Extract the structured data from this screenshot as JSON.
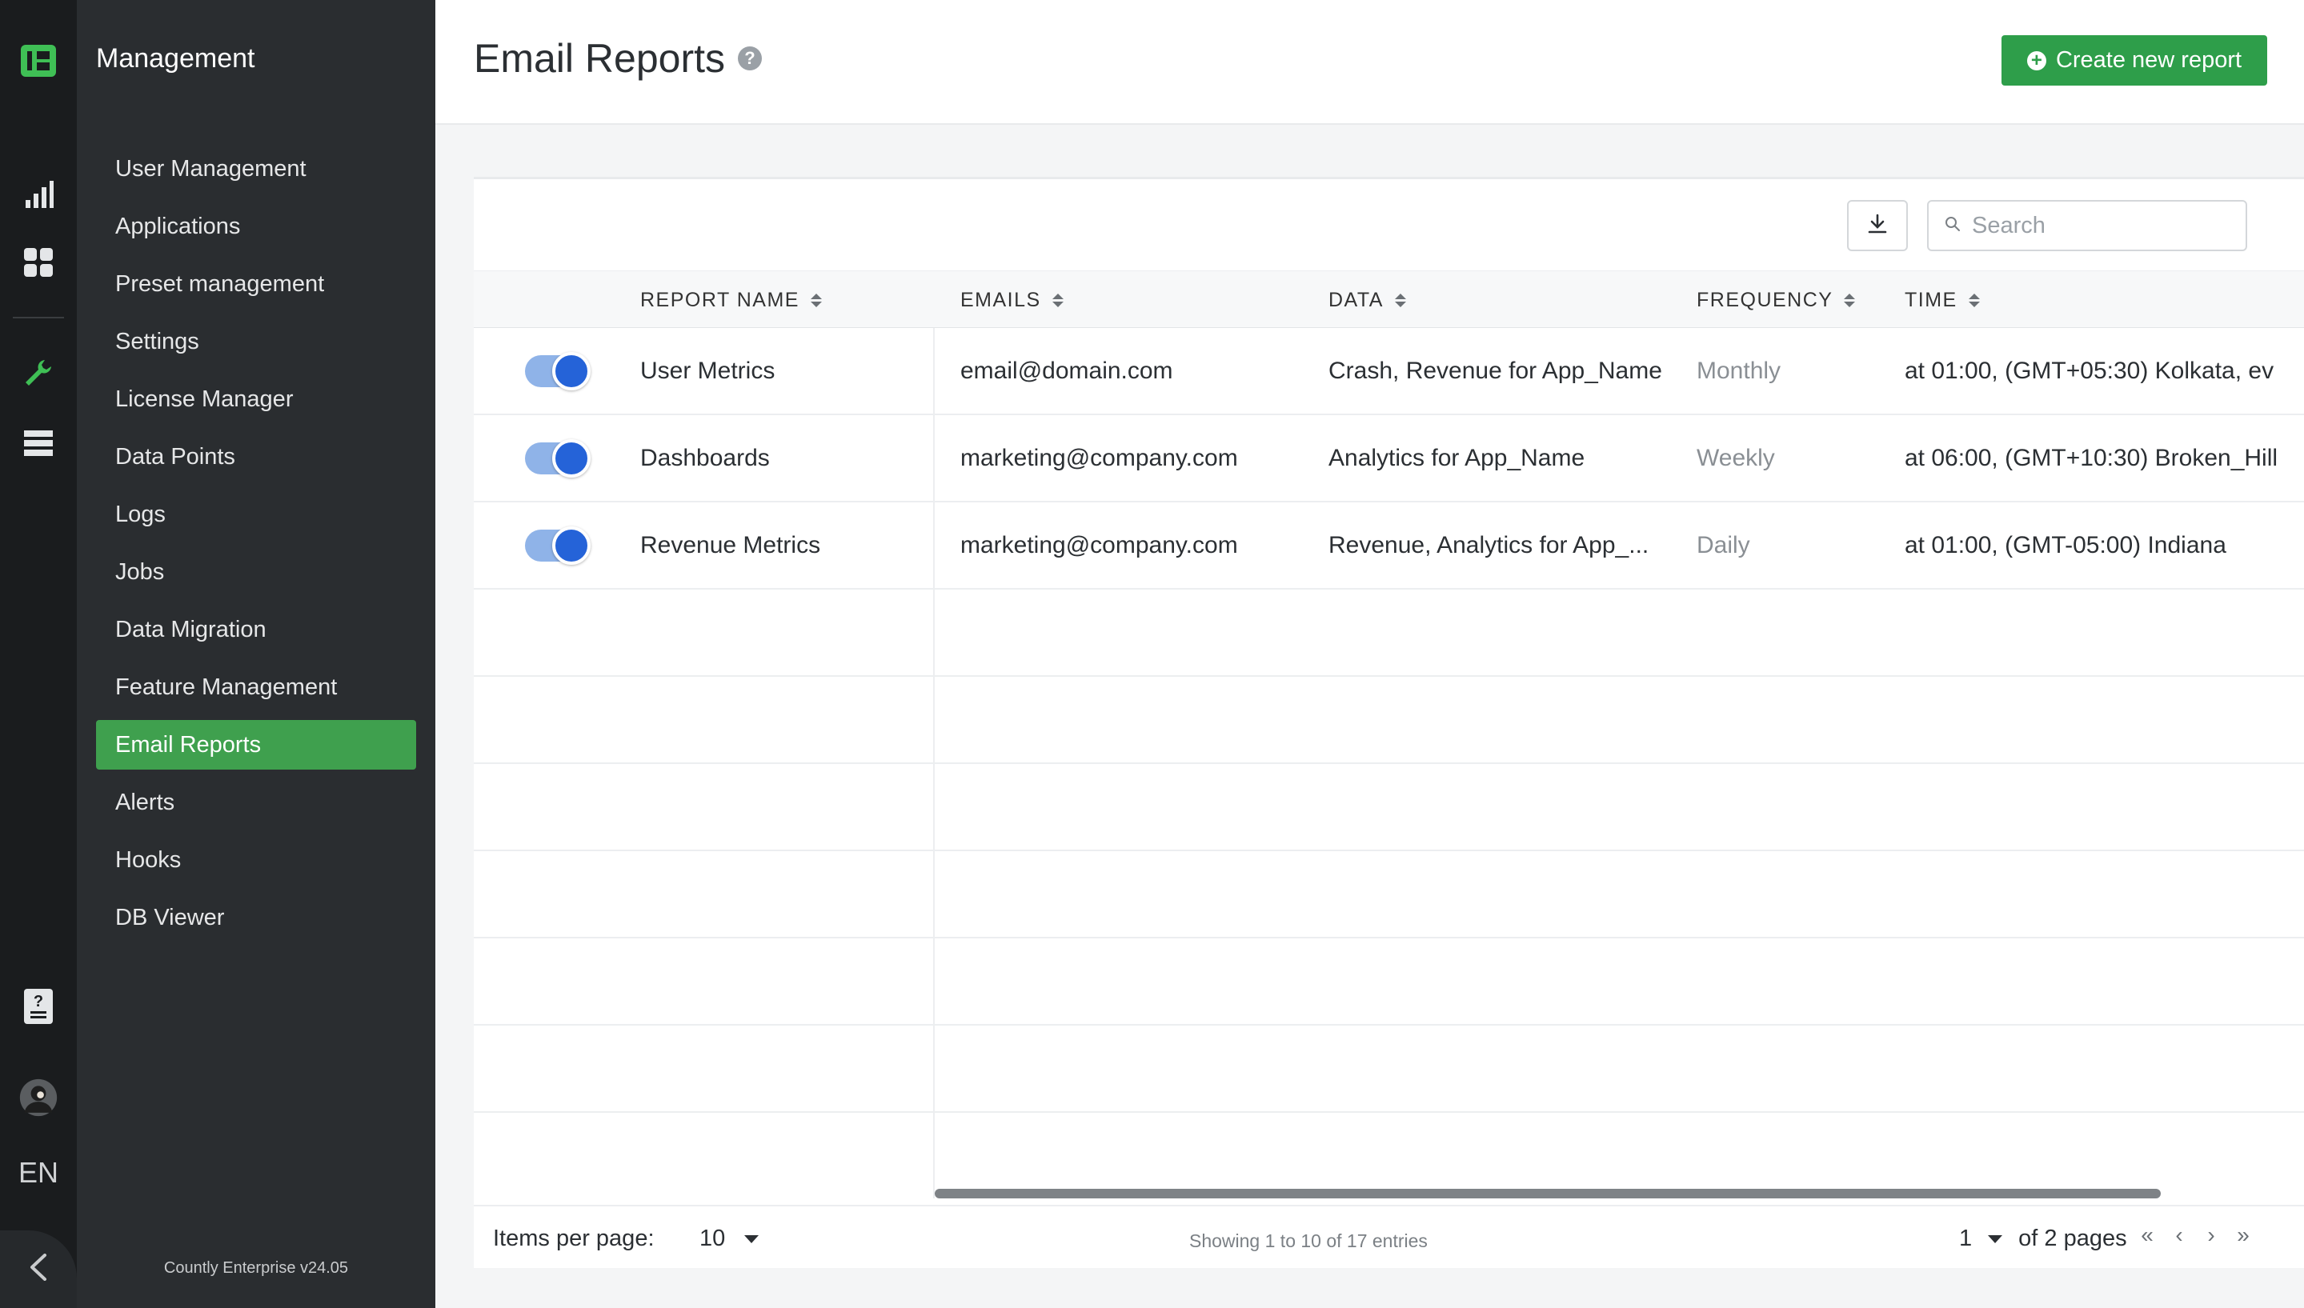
{
  "sidebar": {
    "title": "Management",
    "items": [
      {
        "label": "User Management",
        "active": false
      },
      {
        "label": "Applications",
        "active": false
      },
      {
        "label": "Preset management",
        "active": false
      },
      {
        "label": "Settings",
        "active": false
      },
      {
        "label": "License Manager",
        "active": false
      },
      {
        "label": "Data Points",
        "active": false
      },
      {
        "label": "Logs",
        "active": false
      },
      {
        "label": "Jobs",
        "active": false
      },
      {
        "label": "Data Migration",
        "active": false
      },
      {
        "label": "Feature Management",
        "active": false
      },
      {
        "label": "Email Reports",
        "active": true
      },
      {
        "label": "Alerts",
        "active": false
      },
      {
        "label": "Hooks",
        "active": false
      },
      {
        "label": "DB Viewer",
        "active": false
      }
    ],
    "version": "Countly Enterprise v24.05"
  },
  "rail": {
    "icons": [
      "countly-logo-icon",
      "analytics-bar-chart-icon",
      "dashboard-grid-icon",
      "management-wrench-icon",
      "database-table-icon",
      "help-book-icon",
      "user-avatar-icon",
      "collapse-chevron-icon"
    ],
    "language": "EN"
  },
  "header": {
    "title": "Email Reports",
    "help_glyph": "?",
    "create_label": "Create new report"
  },
  "toolbar": {
    "search_placeholder": "Search"
  },
  "table": {
    "columns": [
      "REPORT NAME",
      "EMAILS",
      "DATA",
      "FREQUENCY",
      "TIME"
    ],
    "rows": [
      {
        "enabled": true,
        "name": "User Metrics",
        "emails": "email@domain.com",
        "data": "Crash, Revenue for App_Name",
        "frequency": "Monthly",
        "time": "at 01:00, (GMT+05:30) Kolkata, ev"
      },
      {
        "enabled": true,
        "name": "Dashboards",
        "emails": "marketing@company.com",
        "data": "Analytics for App_Name",
        "frequency": "Weekly",
        "time": "at 06:00, (GMT+10:30) Broken_Hill"
      },
      {
        "enabled": true,
        "name": "Revenue Metrics",
        "emails": "marketing@company.com",
        "data": "Revenue, Analytics for App_...",
        "frequency": "Daily",
        "time": "at 01:00, (GMT-05:00) Indiana"
      }
    ]
  },
  "footer": {
    "items_per_page_label": "Items per page:",
    "items_per_page": "10",
    "showing": "Showing 1 to 10 of 17 entries",
    "current_page": "1",
    "of_pages": "of 2 pages",
    "nav": [
      "«",
      "‹",
      "›",
      "»"
    ]
  },
  "colors": {
    "accent_green": "#2e9e4a",
    "toggle_blue": "#2563d8",
    "sidebar_bg": "#2a2d30",
    "rail_bg": "#1a1c1e"
  }
}
